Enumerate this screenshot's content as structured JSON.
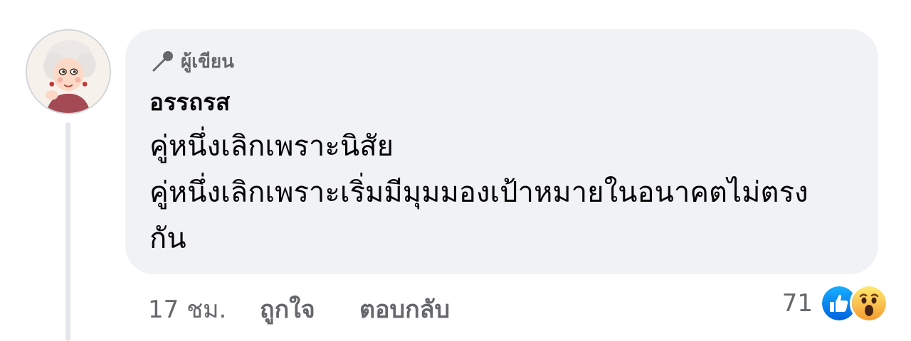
{
  "comment": {
    "badge_label": "ผู้เขียน",
    "author_name": "อรรถรส",
    "text_lines": [
      "คู่หนึ่งเลิกเพราะนิสัย",
      "คู่หนึ่งเลิกเพราะเริ่มมีมุมมองเป้าหมายในอนาคตไม่ตรง",
      "กัน"
    ],
    "timestamp": "17 ชม.",
    "like_label": "ถูกใจ",
    "reply_label": "ตอบกลับ",
    "reaction_count": "71",
    "reaction_icons": [
      "like-icon",
      "wow-icon"
    ]
  },
  "colors": {
    "bubble_bg": "#f0f2f5",
    "secondary_text": "#65676b",
    "primary_text": "#050505",
    "like_blue": "#1877f2",
    "wow_yellow": "#f7b928"
  }
}
